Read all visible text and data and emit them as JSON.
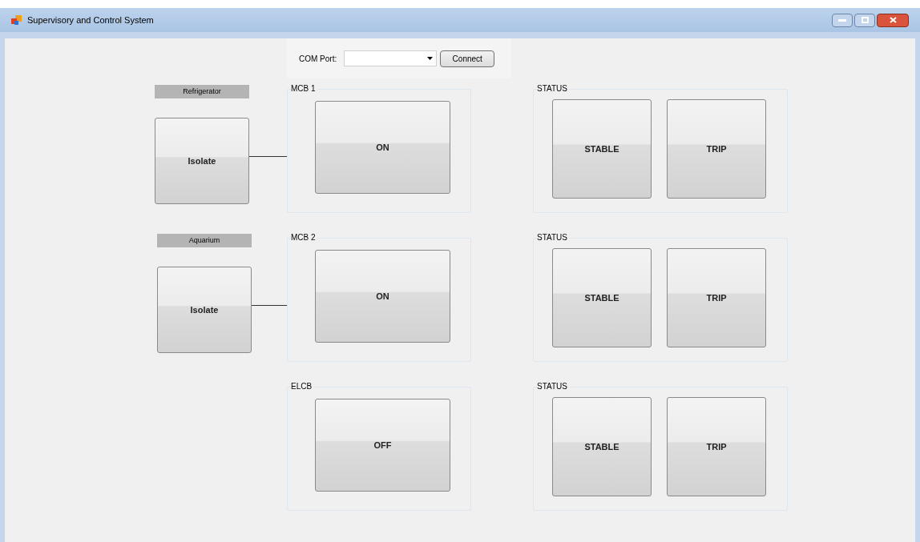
{
  "window": {
    "title": "Supervisory and Control System"
  },
  "connection": {
    "label": "COM Port:",
    "connect_button": "Connect"
  },
  "rows": [
    {
      "load_label": "Refrigerator",
      "isolate_button": "Isolate",
      "breaker": {
        "title": "MCB 1",
        "button": "ON"
      },
      "status": {
        "title": "STATUS",
        "buttons": [
          "STABLE",
          "TRIP"
        ]
      }
    },
    {
      "load_label": "Aquarium",
      "isolate_button": "Isolate",
      "breaker": {
        "title": "MCB 2",
        "button": "ON"
      },
      "status": {
        "title": "STATUS",
        "buttons": [
          "STABLE",
          "TRIP"
        ]
      }
    },
    {
      "breaker": {
        "title": "ELCB",
        "button": "OFF"
      },
      "status": {
        "title": "STATUS",
        "buttons": [
          "STABLE",
          "TRIP"
        ]
      }
    }
  ]
}
